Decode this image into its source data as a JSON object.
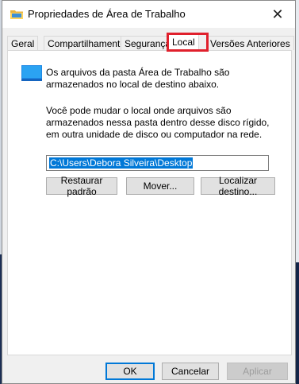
{
  "window": {
    "title": "Propriedades de Área de Trabalho",
    "close_glyph": "✕"
  },
  "tabs": [
    {
      "label": "Geral"
    },
    {
      "label": "Compartilhamento"
    },
    {
      "label": "Segurança"
    },
    {
      "label": "Local",
      "active": true
    },
    {
      "label": "Versões Anteriores"
    }
  ],
  "panel": {
    "info": "Os arquivos da pasta Área de Trabalho são armazenados no local de destino abaixo.",
    "description": "Você pode mudar o local onde arquivos são armazenados nessa pasta dentro desse disco rígido, em outra unidade de disco ou computador na rede.",
    "path_value": "C:\\Users\\Debora Silveira\\Desktop",
    "buttons": {
      "restore": "Restaurar padrão",
      "move": "Mover...",
      "locate": "Localizar destino..."
    }
  },
  "footer": {
    "ok": "OK",
    "cancel": "Cancelar",
    "apply": "Aplicar"
  },
  "colors": {
    "highlight_box": "#e0202c",
    "selection": "#0078d7"
  },
  "icons": {
    "title": "folder-icon",
    "panel": "desktop-folder-icon"
  }
}
